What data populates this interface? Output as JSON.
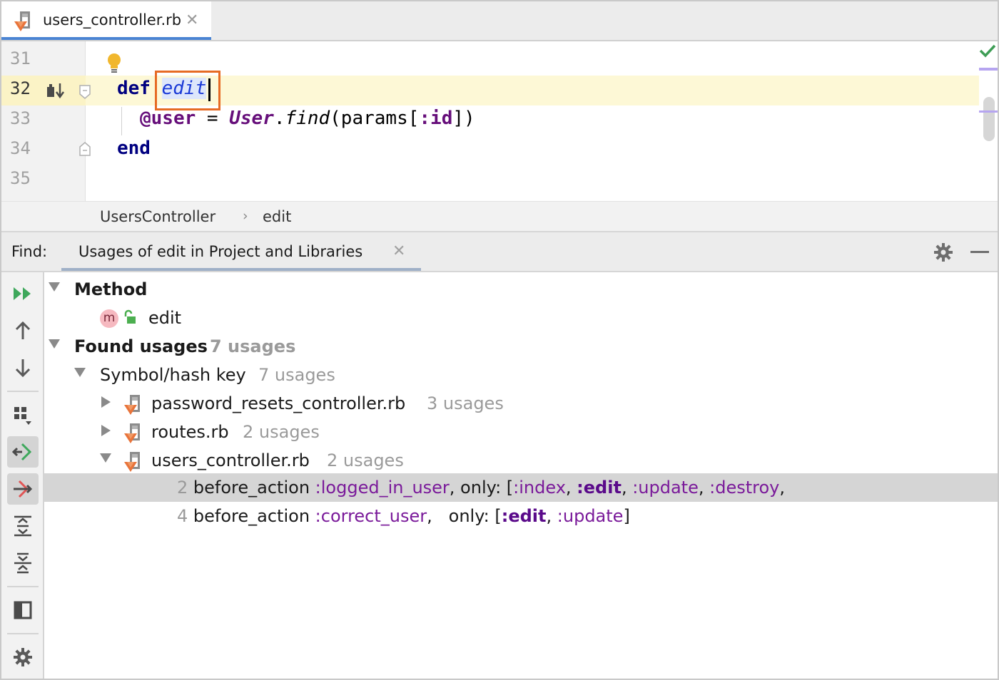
{
  "editor_tab": {
    "filename": "users_controller.rb",
    "close": "✕"
  },
  "editor": {
    "lines": [
      "31",
      "32",
      "33",
      "34",
      "35"
    ],
    "code": {
      "line32_kw": "def",
      "line32_name": "edit",
      "line33_ivar": "@user",
      "line33_eq": " = ",
      "line33_const": "User",
      "line33_dot": ".",
      "line33_meth": "find",
      "line33_open": "(params[",
      "line33_sym": ":id",
      "line33_close": "])",
      "line34_kw": "end"
    }
  },
  "breadcrumb": {
    "items": [
      "UsersController",
      "edit"
    ],
    "separator": "›"
  },
  "find": {
    "label": "Find:",
    "tab_title": "Usages of edit in Project and Libraries",
    "close": "✕"
  },
  "tree": {
    "method_header": "Method",
    "method_icon_letter": "m",
    "method_name": "edit",
    "found_header": "Found usages",
    "found_count": "7 usages",
    "group_label": "Symbol/hash key",
    "group_count": "7 usages",
    "files": [
      {
        "name": "password_resets_controller.rb",
        "count": "3 usages"
      },
      {
        "name": "routes.rb",
        "count": "2 usages"
      },
      {
        "name": "users_controller.rb",
        "count": "2 usages"
      }
    ],
    "usage1": {
      "line": "2",
      "call": " before_action ",
      "sym1": ":logged_in_user",
      "mid": ", only: [",
      "s_index": ":index",
      "c1": ", ",
      "s_edit": ":edit",
      "c2": ", ",
      "s_update": ":update",
      "c3": ", ",
      "s_destroy": ":destroy",
      "end": ","
    },
    "usage2": {
      "line": "4",
      "call": " before_action ",
      "sym1": ":correct_user",
      "mid": ",   only: [",
      "s_edit": ":edit",
      "c1": ", ",
      "s_update": ":update",
      "end": "]"
    }
  },
  "colors": {
    "accent_tab": "#4a84d3",
    "highlight_border": "#e66b24",
    "current_line": "#fdf8d6",
    "keyword": "#000080",
    "symbol": "#7a1a9a"
  }
}
